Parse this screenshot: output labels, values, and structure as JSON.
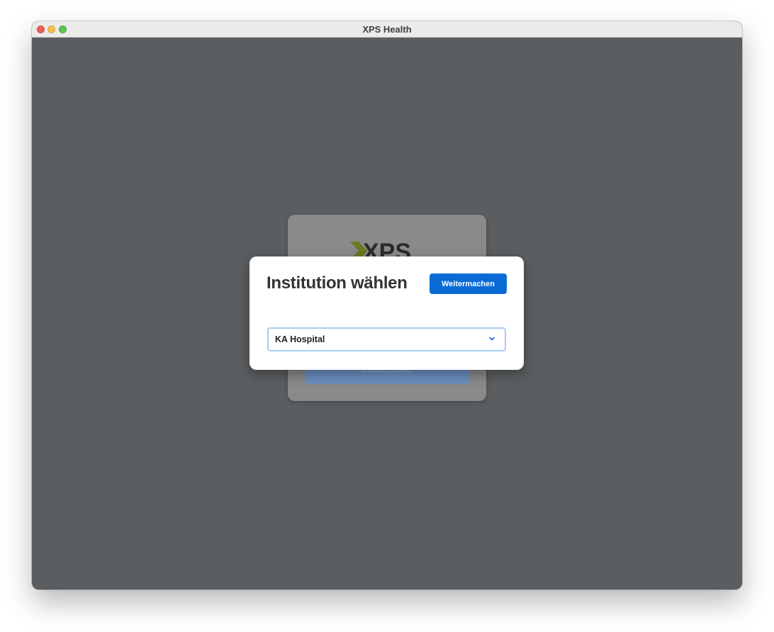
{
  "window": {
    "title": "XPS Health"
  },
  "background_login": {
    "logo_text": "XPS",
    "login_button_label": "ANMELDUNG"
  },
  "modal": {
    "title": "Institution wählen",
    "continue_label": "Weitermachen",
    "institution_select": {
      "selected_value": "KA Hospital",
      "icon": "chevron-down-icon"
    }
  },
  "colors": {
    "accent": "#0b6bd6",
    "overlay": "#5b5e60",
    "select_focus_border": "#a8cdf3"
  }
}
